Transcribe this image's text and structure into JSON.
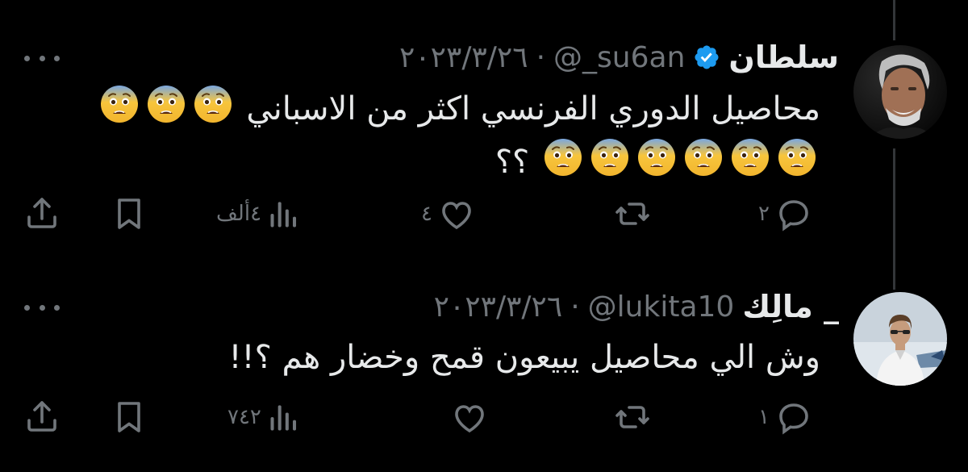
{
  "tweets": [
    {
      "display_name": "سلطان",
      "verified": true,
      "handle": "@_su6an",
      "separator": "·",
      "date": "٢٠٢٣/٣/٢٦",
      "text_line1": "محاصيل الدوري الفرنسي اكثر من الاسباني",
      "text_line2": "؟؟",
      "emoji": "fearful-face",
      "emoji_count_line1": 3,
      "emoji_count_line2": 6,
      "actions": {
        "replies": "٢",
        "retweets": "",
        "likes": "٤",
        "views": "٤ألف"
      }
    },
    {
      "display_name": "مالِك _",
      "verified": false,
      "handle": "@lukita10",
      "separator": "·",
      "date": "٢٠٢٣/٣/٢٦",
      "text_line1": "وش الي محاصيل يبيعون قمح وخضار هم ؟!!",
      "actions": {
        "replies": "١",
        "retweets": "",
        "likes": "",
        "views": "٧٤٢"
      }
    }
  ],
  "colors": {
    "background": "#000000",
    "text": "#e7e9ea",
    "muted": "#71767b",
    "verified": "#1d9bf0",
    "emoji": "#f7c53c"
  },
  "icons": [
    "reply-icon",
    "retweet-icon",
    "like-icon",
    "views-icon",
    "bookmark-icon",
    "share-icon",
    "more-icon",
    "verified-icon",
    "fearful-face-emoji"
  ]
}
